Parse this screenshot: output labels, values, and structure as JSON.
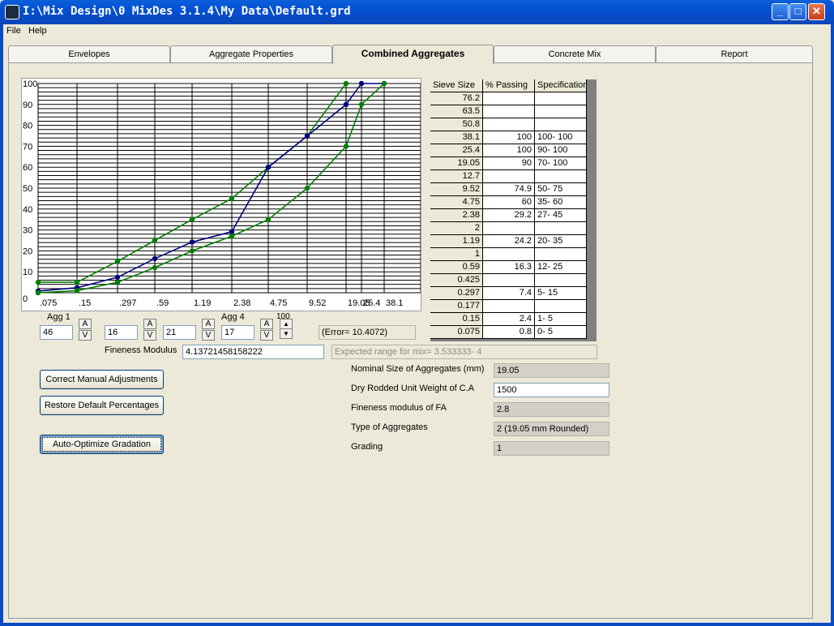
{
  "window": {
    "title": "I:\\Mix Design\\0 MixDes 3.1.4\\My Data\\Default.grd",
    "minimize_label": "_",
    "maximize_label": "□",
    "close_label": "✕"
  },
  "menu": {
    "file": "File",
    "help": "Help"
  },
  "tabs": [
    "Envelopes",
    "Aggregate Properties",
    "Combined Aggregates",
    "Concrete Mix",
    "Report"
  ],
  "active_tab": "Combined Aggregates",
  "chart_data": {
    "type": "line",
    "x_tick_labels": [
      ".075",
      ".15",
      ".297",
      ".59",
      "1.19",
      "2.38",
      "4.75",
      "9.52",
      "19.05",
      "25.4",
      "38.1"
    ],
    "y_tick_labels": [
      "0",
      "10",
      "20",
      "30",
      "40",
      "50",
      "60",
      "70",
      "80",
      "90",
      "100"
    ],
    "ylim": [
      0,
      100
    ],
    "grid": true,
    "series": [
      {
        "role": "upper-limit",
        "color": "#008000",
        "values": [
          5,
          5,
          15,
          25,
          35,
          45,
          60,
          75,
          100,
          null,
          null
        ]
      },
      {
        "role": "combined-mix",
        "color": "#000080",
        "values": [
          0.8,
          2.4,
          7.4,
          16.3,
          24.2,
          29.2,
          60,
          74.9,
          90,
          100,
          100
        ]
      },
      {
        "role": "lower-limit",
        "color": "#008000",
        "values": [
          0,
          1,
          5,
          12,
          20,
          27,
          35,
          50,
          70,
          90,
          100
        ]
      }
    ]
  },
  "sieve_table": {
    "headers": [
      "Sieve Size",
      "% Passing",
      "Specification"
    ],
    "rows": [
      [
        "76.2",
        "",
        ""
      ],
      [
        "63.5",
        "",
        ""
      ],
      [
        "50.8",
        "",
        ""
      ],
      [
        "38.1",
        "100",
        "100- 100"
      ],
      [
        "25.4",
        "100",
        "90- 100"
      ],
      [
        "19.05",
        "90",
        "70- 100"
      ],
      [
        "12.7",
        "",
        ""
      ],
      [
        "9.52",
        "74.9",
        "50- 75"
      ],
      [
        "4.75",
        "60",
        "35- 60"
      ],
      [
        "2.38",
        "29.2",
        "27- 45"
      ],
      [
        "2",
        "",
        ""
      ],
      [
        "1.19",
        "24.2",
        "20- 35"
      ],
      [
        "1",
        "",
        ""
      ],
      [
        "0.59",
        "16.3",
        "12- 25"
      ],
      [
        "0.425",
        "",
        ""
      ],
      [
        "0.297",
        "7.4",
        "5- 15"
      ],
      [
        "0.177",
        "",
        ""
      ],
      [
        "0.15",
        "2.4",
        "1- 5"
      ],
      [
        "0.075",
        "0.8",
        "0- 5"
      ]
    ]
  },
  "aggregates": {
    "agg1_label": "Agg 1",
    "agg4_label": "Agg 4",
    "spin_total_label": "100",
    "values": [
      "46",
      "16",
      "21",
      "17"
    ],
    "up_glyph": "A",
    "down_glyph": "V",
    "spin_up_glyph": "▲",
    "spin_down_glyph": "▼",
    "error_text": "(Error= 10.4072)"
  },
  "fineness": {
    "label": "Fineness Modulus",
    "value": "4.13721458158222",
    "expected_range": "Expected range for mix= 3.533333- 4"
  },
  "buttons": {
    "correct": "Correct Manual Adjustments",
    "restore": "Restore Default Percentages",
    "optimize": "Auto-Optimize Gradation"
  },
  "properties": {
    "nominal_size_label": "Nominal Size of Aggregates (mm)",
    "nominal_size_value": "19.05",
    "dry_rodded_label": "Dry Rodded Unit Weight of C.A",
    "dry_rodded_value": "1500",
    "fm_fa_label": "Fineness modulus of FA",
    "fm_fa_value": "2.8",
    "type_label": "Type of Aggregates",
    "type_value": "2 (19.05 mm Rounded)",
    "grading_label": "Grading",
    "grading_value": "1"
  }
}
